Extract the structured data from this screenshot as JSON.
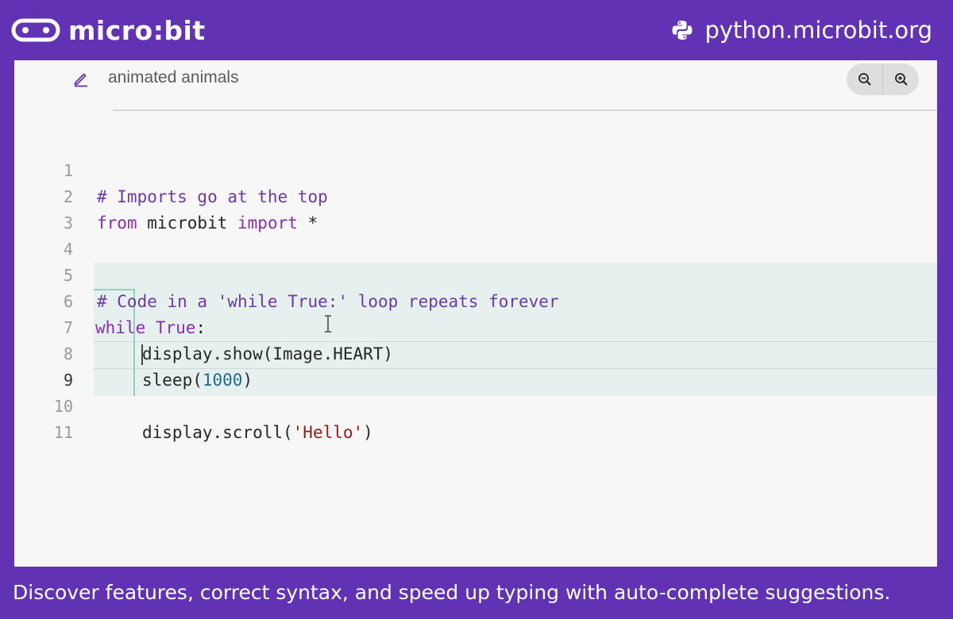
{
  "header": {
    "brand_name": "micro:bit",
    "site_url": "python.microbit.org"
  },
  "editor": {
    "project_name": "animated animals",
    "active_line": 9,
    "code_lines": [
      {
        "n": "1",
        "text": "# Imports go at the top"
      },
      {
        "n": "2",
        "text": "from microbit import *"
      },
      {
        "n": "3",
        "text": ""
      },
      {
        "n": "4",
        "text": ""
      },
      {
        "n": "5",
        "text": "# Code in a 'while True:' loop repeats forever"
      },
      {
        "n": "6",
        "text": "while True:"
      },
      {
        "n": "7",
        "text": "display.show(Image.HEART)"
      },
      {
        "n": "8",
        "text": "sleep(1000)"
      },
      {
        "n": "9",
        "text": ""
      },
      {
        "n": "10",
        "text": "display.scroll('Hello')"
      },
      {
        "n": "11",
        "text": ""
      }
    ],
    "tokens": {
      "l2_kw_from": "from",
      "l2_mid": " microbit ",
      "l2_kw_import": "import",
      "l2_end": " *",
      "l6_kw_while": "while",
      "l6_kw_true": "True",
      "l6_end": ":",
      "l8_start": "sleep(",
      "l8_num": "1000",
      "l8_end": ")",
      "l10_start": "display.scroll(",
      "l10_str": "'Hello'",
      "l10_end": ")"
    }
  },
  "caption": "Discover features, correct syntax, and speed up typing with auto-complete suggestions.",
  "colors": {
    "brand_purple": "#6132b4",
    "editor_bg": "#f7f7f7",
    "block_highlight": "#e6f0ee",
    "keyword": "#8a2fb0",
    "comment": "#6b3aa6",
    "number": "#1e6b8c",
    "string": "#8f1d1d"
  },
  "icons": [
    "microbit-logo-icon",
    "python-icon",
    "edit-pencil-icon",
    "zoom-out-icon",
    "zoom-in-icon",
    "text-cursor-icon"
  ]
}
